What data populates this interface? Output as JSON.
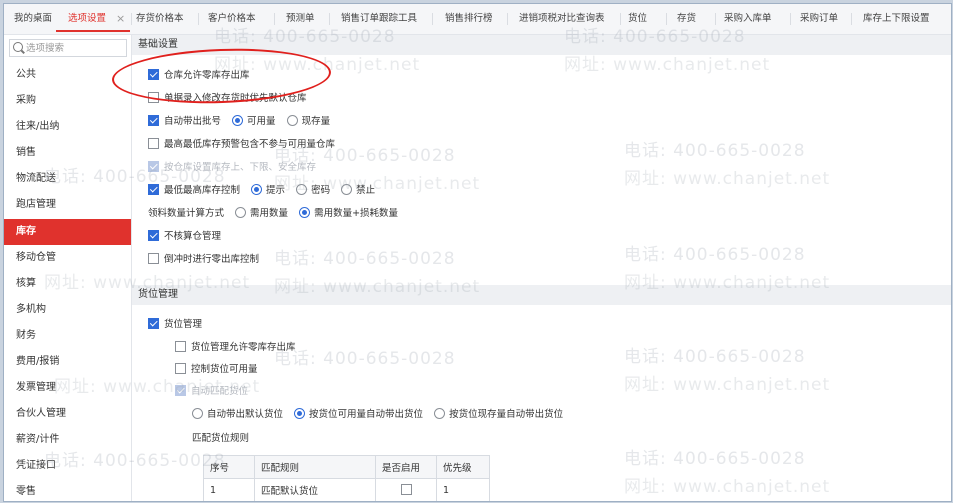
{
  "tabs": [
    {
      "label": "我的桌面",
      "active": false
    },
    {
      "label": "选项设置",
      "active": true
    },
    {
      "label": "存货价格本",
      "active": false
    },
    {
      "label": "客户价格本",
      "active": false
    },
    {
      "label": "预测单",
      "active": false
    },
    {
      "label": "销售订单跟踪工具",
      "active": false
    },
    {
      "label": "销售排行榜",
      "active": false
    },
    {
      "label": "进销项税对比查询表",
      "active": false
    },
    {
      "label": "货位",
      "active": false
    },
    {
      "label": "存货",
      "active": false
    },
    {
      "label": "采购入库单",
      "active": false
    },
    {
      "label": "采购订单",
      "active": false
    },
    {
      "label": "库存上下限设置",
      "active": false
    }
  ],
  "tab_close": "×",
  "search": {
    "placeholder": "选项搜索",
    "value": ""
  },
  "sidebar": {
    "items": [
      "公共",
      "采购",
      "往来/出纳",
      "销售",
      "物流配送",
      "跑店管理",
      "库存",
      "移动仓管",
      "核算",
      "多机构",
      "财务",
      "费用/报销",
      "发票管理",
      "合伙人管理",
      "薪资/计件",
      "凭证接口",
      "零售"
    ],
    "active_index": 6
  },
  "basic": {
    "title": "基础设置",
    "allow_zero_stock_out": "仓库允许零库存出库",
    "single_entry_default_wh": "单据录入修改存货时优先默认仓库",
    "auto_batch": "自动带出批号",
    "auto_batch_options": [
      "可用量",
      "现存量"
    ],
    "auto_batch_selected": 0,
    "min_stock_plan": "最高最低库存预警包含不参与可用量仓库",
    "by_wh_setting": "按仓库设置库存上、下限、安全库存",
    "min_max_control": "最低最高库存控制",
    "control_options": [
      "提示",
      "密码",
      "禁止"
    ],
    "control_selected": 0,
    "pick_calc_label": "领料数量计算方式",
    "pick_calc_options": [
      "需用数量",
      "需用数量+损耗数量"
    ],
    "pick_calc_selected": 1,
    "no_sub_wh": "不核算仓管理",
    "offset_zero_control": "倒冲时进行零出库控制"
  },
  "location": {
    "title": "货位管理",
    "enable": "货位管理",
    "allow_zero_out": "货位管理允许零库存出库",
    "control_available": "控制货位可用量",
    "auto_match": "自动匹配货位",
    "match_options": [
      "自动带出默认货位",
      "按货位可用量自动带出货位",
      "按货位现存量自动带出货位"
    ],
    "match_selected": 1,
    "rules_label": "匹配货位规则",
    "table": {
      "headers": [
        "序号",
        "匹配规则",
        "是否启用",
        "优先级"
      ],
      "rows": [
        [
          "1",
          "匹配默认货位",
          "",
          "1"
        ]
      ]
    }
  },
  "watermark": {
    "phone": "电话: 400-665-0028",
    "site": "网址: www.chanjet.net"
  },
  "colors": {
    "accent": "#e0322d",
    "checkbox": "#2f6bd8",
    "annotation": "#e0201d"
  }
}
